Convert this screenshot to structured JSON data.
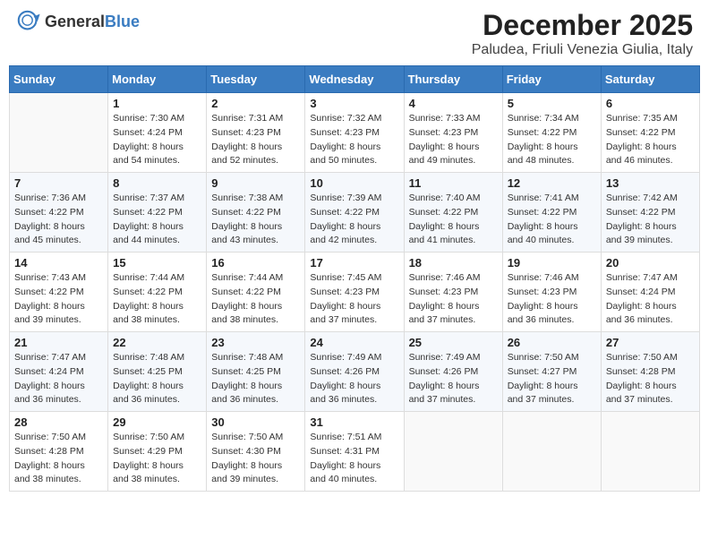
{
  "header": {
    "logo_general": "General",
    "logo_blue": "Blue",
    "month_title": "December 2025",
    "location": "Paludea, Friuli Venezia Giulia, Italy"
  },
  "days_of_week": [
    "Sunday",
    "Monday",
    "Tuesday",
    "Wednesday",
    "Thursday",
    "Friday",
    "Saturday"
  ],
  "weeks": [
    [
      {
        "day": "",
        "sunrise": "",
        "sunset": "",
        "daylight": ""
      },
      {
        "day": "1",
        "sunrise": "Sunrise: 7:30 AM",
        "sunset": "Sunset: 4:24 PM",
        "daylight": "Daylight: 8 hours and 54 minutes."
      },
      {
        "day": "2",
        "sunrise": "Sunrise: 7:31 AM",
        "sunset": "Sunset: 4:23 PM",
        "daylight": "Daylight: 8 hours and 52 minutes."
      },
      {
        "day": "3",
        "sunrise": "Sunrise: 7:32 AM",
        "sunset": "Sunset: 4:23 PM",
        "daylight": "Daylight: 8 hours and 50 minutes."
      },
      {
        "day": "4",
        "sunrise": "Sunrise: 7:33 AM",
        "sunset": "Sunset: 4:23 PM",
        "daylight": "Daylight: 8 hours and 49 minutes."
      },
      {
        "day": "5",
        "sunrise": "Sunrise: 7:34 AM",
        "sunset": "Sunset: 4:22 PM",
        "daylight": "Daylight: 8 hours and 48 minutes."
      },
      {
        "day": "6",
        "sunrise": "Sunrise: 7:35 AM",
        "sunset": "Sunset: 4:22 PM",
        "daylight": "Daylight: 8 hours and 46 minutes."
      }
    ],
    [
      {
        "day": "7",
        "sunrise": "Sunrise: 7:36 AM",
        "sunset": "Sunset: 4:22 PM",
        "daylight": "Daylight: 8 hours and 45 minutes."
      },
      {
        "day": "8",
        "sunrise": "Sunrise: 7:37 AM",
        "sunset": "Sunset: 4:22 PM",
        "daylight": "Daylight: 8 hours and 44 minutes."
      },
      {
        "day": "9",
        "sunrise": "Sunrise: 7:38 AM",
        "sunset": "Sunset: 4:22 PM",
        "daylight": "Daylight: 8 hours and 43 minutes."
      },
      {
        "day": "10",
        "sunrise": "Sunrise: 7:39 AM",
        "sunset": "Sunset: 4:22 PM",
        "daylight": "Daylight: 8 hours and 42 minutes."
      },
      {
        "day": "11",
        "sunrise": "Sunrise: 7:40 AM",
        "sunset": "Sunset: 4:22 PM",
        "daylight": "Daylight: 8 hours and 41 minutes."
      },
      {
        "day": "12",
        "sunrise": "Sunrise: 7:41 AM",
        "sunset": "Sunset: 4:22 PM",
        "daylight": "Daylight: 8 hours and 40 minutes."
      },
      {
        "day": "13",
        "sunrise": "Sunrise: 7:42 AM",
        "sunset": "Sunset: 4:22 PM",
        "daylight": "Daylight: 8 hours and 39 minutes."
      }
    ],
    [
      {
        "day": "14",
        "sunrise": "Sunrise: 7:43 AM",
        "sunset": "Sunset: 4:22 PM",
        "daylight": "Daylight: 8 hours and 39 minutes."
      },
      {
        "day": "15",
        "sunrise": "Sunrise: 7:44 AM",
        "sunset": "Sunset: 4:22 PM",
        "daylight": "Daylight: 8 hours and 38 minutes."
      },
      {
        "day": "16",
        "sunrise": "Sunrise: 7:44 AM",
        "sunset": "Sunset: 4:22 PM",
        "daylight": "Daylight: 8 hours and 38 minutes."
      },
      {
        "day": "17",
        "sunrise": "Sunrise: 7:45 AM",
        "sunset": "Sunset: 4:23 PM",
        "daylight": "Daylight: 8 hours and 37 minutes."
      },
      {
        "day": "18",
        "sunrise": "Sunrise: 7:46 AM",
        "sunset": "Sunset: 4:23 PM",
        "daylight": "Daylight: 8 hours and 37 minutes."
      },
      {
        "day": "19",
        "sunrise": "Sunrise: 7:46 AM",
        "sunset": "Sunset: 4:23 PM",
        "daylight": "Daylight: 8 hours and 36 minutes."
      },
      {
        "day": "20",
        "sunrise": "Sunrise: 7:47 AM",
        "sunset": "Sunset: 4:24 PM",
        "daylight": "Daylight: 8 hours and 36 minutes."
      }
    ],
    [
      {
        "day": "21",
        "sunrise": "Sunrise: 7:47 AM",
        "sunset": "Sunset: 4:24 PM",
        "daylight": "Daylight: 8 hours and 36 minutes."
      },
      {
        "day": "22",
        "sunrise": "Sunrise: 7:48 AM",
        "sunset": "Sunset: 4:25 PM",
        "daylight": "Daylight: 8 hours and 36 minutes."
      },
      {
        "day": "23",
        "sunrise": "Sunrise: 7:48 AM",
        "sunset": "Sunset: 4:25 PM",
        "daylight": "Daylight: 8 hours and 36 minutes."
      },
      {
        "day": "24",
        "sunrise": "Sunrise: 7:49 AM",
        "sunset": "Sunset: 4:26 PM",
        "daylight": "Daylight: 8 hours and 36 minutes."
      },
      {
        "day": "25",
        "sunrise": "Sunrise: 7:49 AM",
        "sunset": "Sunset: 4:26 PM",
        "daylight": "Daylight: 8 hours and 37 minutes."
      },
      {
        "day": "26",
        "sunrise": "Sunrise: 7:50 AM",
        "sunset": "Sunset: 4:27 PM",
        "daylight": "Daylight: 8 hours and 37 minutes."
      },
      {
        "day": "27",
        "sunrise": "Sunrise: 7:50 AM",
        "sunset": "Sunset: 4:28 PM",
        "daylight": "Daylight: 8 hours and 37 minutes."
      }
    ],
    [
      {
        "day": "28",
        "sunrise": "Sunrise: 7:50 AM",
        "sunset": "Sunset: 4:28 PM",
        "daylight": "Daylight: 8 hours and 38 minutes."
      },
      {
        "day": "29",
        "sunrise": "Sunrise: 7:50 AM",
        "sunset": "Sunset: 4:29 PM",
        "daylight": "Daylight: 8 hours and 38 minutes."
      },
      {
        "day": "30",
        "sunrise": "Sunrise: 7:50 AM",
        "sunset": "Sunset: 4:30 PM",
        "daylight": "Daylight: 8 hours and 39 minutes."
      },
      {
        "day": "31",
        "sunrise": "Sunrise: 7:51 AM",
        "sunset": "Sunset: 4:31 PM",
        "daylight": "Daylight: 8 hours and 40 minutes."
      },
      {
        "day": "",
        "sunrise": "",
        "sunset": "",
        "daylight": ""
      },
      {
        "day": "",
        "sunrise": "",
        "sunset": "",
        "daylight": ""
      },
      {
        "day": "",
        "sunrise": "",
        "sunset": "",
        "daylight": ""
      }
    ]
  ]
}
